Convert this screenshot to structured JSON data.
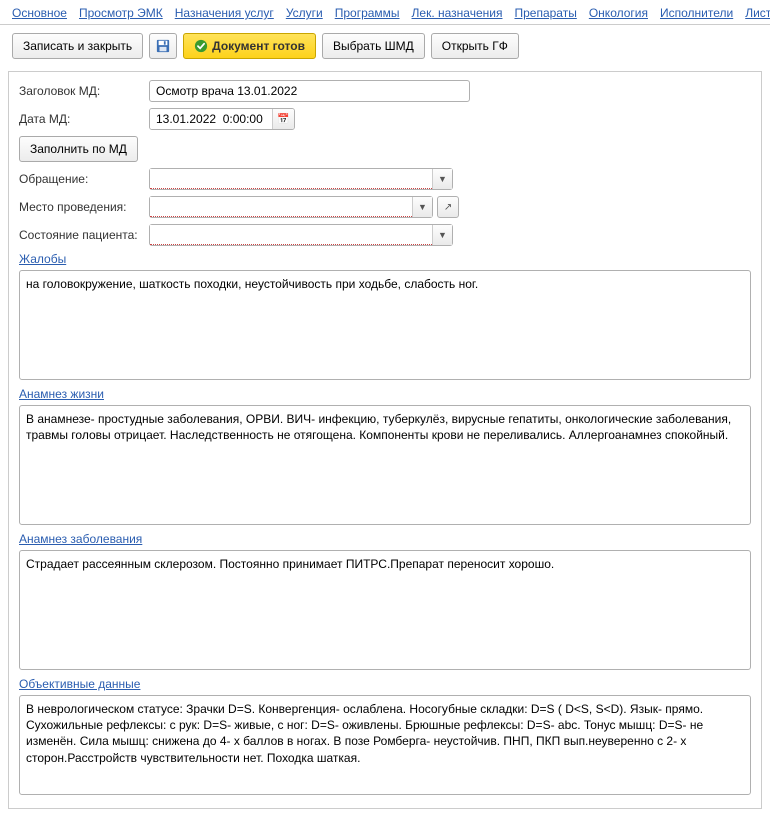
{
  "nav": {
    "items": [
      "Основное",
      "Просмотр ЭМК",
      "Назначения услуг",
      "Услуги",
      "Программы",
      "Лек. назначения",
      "Препараты",
      "Онкология",
      "Исполнители",
      "Листки нетрудос"
    ]
  },
  "toolbar": {
    "save_close": "Записать и закрыть",
    "doc_ready": "Документ готов",
    "select_shmd": "Выбрать ШМД",
    "open_gf": "Открыть ГФ"
  },
  "form": {
    "title_label": "Заголовок МД:",
    "title_value": "Осмотр врача 13.01.2022",
    "date_label": "Дата МД:",
    "date_value": "13.01.2022  0:00:00",
    "fill_by_md": "Заполнить по МД",
    "appeal_label": "Обращение:",
    "appeal_value": "",
    "place_label": "Место проведения:",
    "place_value": "",
    "state_label": "Состояние пациента:",
    "state_value": ""
  },
  "sections": {
    "complaints_label": "Жалобы",
    "complaints_text": "на головокружение, шаткость походки, неустойчивость при ходьбе, слабость ног.",
    "anamnesis_life_label": "Анамнез жизни",
    "anamnesis_life_text": "В анамнезе- простудные заболевания, ОРВИ. ВИЧ- инфекцию, туберкулёз, вирусные гепатиты, онкологические заболевания, травмы головы отрицает. Наследственность не отягощена. Компоненты крови не переливались. Аллергоанамнез спокойный.",
    "anamnesis_disease_label": "Анамнез заболевания",
    "anamnesis_disease_text": "Страдает рассеянным склерозом. Постоянно принимает ПИТРС.Препарат переносит хорошо.",
    "objective_label": "Объективные данные",
    "objective_text": "В неврологическом статусе: Зрачки D=S. Конвергенция- ослаблена. Носогубные складки: D=S ( D<S, S<D). Язык- прямо. Сухожильные рефлексы: с рук: D=S- живые, с ног: D=S- оживлены. Брюшные рефлексы: D=S- abc. Тонус мышц: D=S- не изменён. Сила мышц: снижена до 4- х баллов в ногах. В позе Ромберга- неустойчив. ПНП, ПКП вып.неуверенно с 2- х сторон.Расстройств чувствительности нет. Походка шаткая."
  }
}
